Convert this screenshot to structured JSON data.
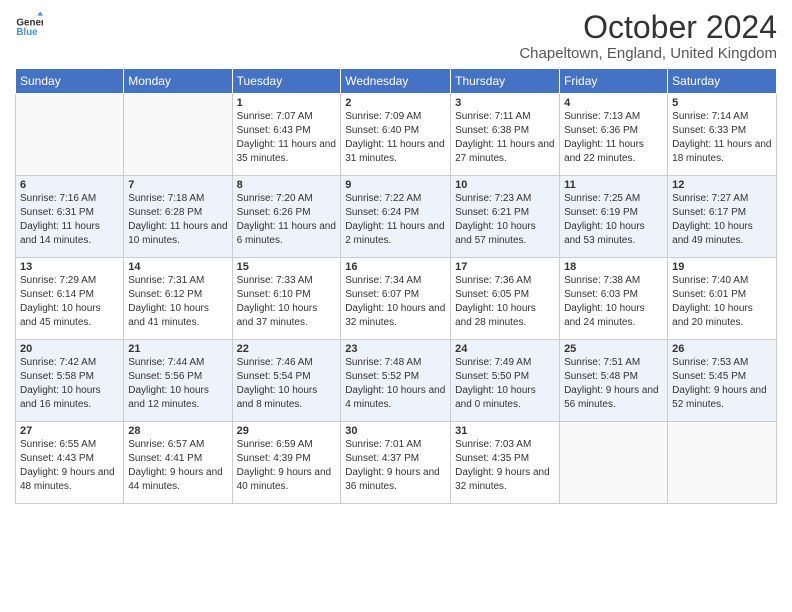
{
  "header": {
    "logo_line1": "General",
    "logo_line2": "Blue",
    "month_title": "October 2024",
    "subtitle": "Chapeltown, England, United Kingdom"
  },
  "days_of_week": [
    "Sunday",
    "Monday",
    "Tuesday",
    "Wednesday",
    "Thursday",
    "Friday",
    "Saturday"
  ],
  "weeks": [
    [
      {
        "day": "",
        "info": ""
      },
      {
        "day": "",
        "info": ""
      },
      {
        "day": "1",
        "info": "Sunrise: 7:07 AM\nSunset: 6:43 PM\nDaylight: 11 hours and 35 minutes."
      },
      {
        "day": "2",
        "info": "Sunrise: 7:09 AM\nSunset: 6:40 PM\nDaylight: 11 hours and 31 minutes."
      },
      {
        "day": "3",
        "info": "Sunrise: 7:11 AM\nSunset: 6:38 PM\nDaylight: 11 hours and 27 minutes."
      },
      {
        "day": "4",
        "info": "Sunrise: 7:13 AM\nSunset: 6:36 PM\nDaylight: 11 hours and 22 minutes."
      },
      {
        "day": "5",
        "info": "Sunrise: 7:14 AM\nSunset: 6:33 PM\nDaylight: 11 hours and 18 minutes."
      }
    ],
    [
      {
        "day": "6",
        "info": "Sunrise: 7:16 AM\nSunset: 6:31 PM\nDaylight: 11 hours and 14 minutes."
      },
      {
        "day": "7",
        "info": "Sunrise: 7:18 AM\nSunset: 6:28 PM\nDaylight: 11 hours and 10 minutes."
      },
      {
        "day": "8",
        "info": "Sunrise: 7:20 AM\nSunset: 6:26 PM\nDaylight: 11 hours and 6 minutes."
      },
      {
        "day": "9",
        "info": "Sunrise: 7:22 AM\nSunset: 6:24 PM\nDaylight: 11 hours and 2 minutes."
      },
      {
        "day": "10",
        "info": "Sunrise: 7:23 AM\nSunset: 6:21 PM\nDaylight: 10 hours and 57 minutes."
      },
      {
        "day": "11",
        "info": "Sunrise: 7:25 AM\nSunset: 6:19 PM\nDaylight: 10 hours and 53 minutes."
      },
      {
        "day": "12",
        "info": "Sunrise: 7:27 AM\nSunset: 6:17 PM\nDaylight: 10 hours and 49 minutes."
      }
    ],
    [
      {
        "day": "13",
        "info": "Sunrise: 7:29 AM\nSunset: 6:14 PM\nDaylight: 10 hours and 45 minutes."
      },
      {
        "day": "14",
        "info": "Sunrise: 7:31 AM\nSunset: 6:12 PM\nDaylight: 10 hours and 41 minutes."
      },
      {
        "day": "15",
        "info": "Sunrise: 7:33 AM\nSunset: 6:10 PM\nDaylight: 10 hours and 37 minutes."
      },
      {
        "day": "16",
        "info": "Sunrise: 7:34 AM\nSunset: 6:07 PM\nDaylight: 10 hours and 32 minutes."
      },
      {
        "day": "17",
        "info": "Sunrise: 7:36 AM\nSunset: 6:05 PM\nDaylight: 10 hours and 28 minutes."
      },
      {
        "day": "18",
        "info": "Sunrise: 7:38 AM\nSunset: 6:03 PM\nDaylight: 10 hours and 24 minutes."
      },
      {
        "day": "19",
        "info": "Sunrise: 7:40 AM\nSunset: 6:01 PM\nDaylight: 10 hours and 20 minutes."
      }
    ],
    [
      {
        "day": "20",
        "info": "Sunrise: 7:42 AM\nSunset: 5:58 PM\nDaylight: 10 hours and 16 minutes."
      },
      {
        "day": "21",
        "info": "Sunrise: 7:44 AM\nSunset: 5:56 PM\nDaylight: 10 hours and 12 minutes."
      },
      {
        "day": "22",
        "info": "Sunrise: 7:46 AM\nSunset: 5:54 PM\nDaylight: 10 hours and 8 minutes."
      },
      {
        "day": "23",
        "info": "Sunrise: 7:48 AM\nSunset: 5:52 PM\nDaylight: 10 hours and 4 minutes."
      },
      {
        "day": "24",
        "info": "Sunrise: 7:49 AM\nSunset: 5:50 PM\nDaylight: 10 hours and 0 minutes."
      },
      {
        "day": "25",
        "info": "Sunrise: 7:51 AM\nSunset: 5:48 PM\nDaylight: 9 hours and 56 minutes."
      },
      {
        "day": "26",
        "info": "Sunrise: 7:53 AM\nSunset: 5:45 PM\nDaylight: 9 hours and 52 minutes."
      }
    ],
    [
      {
        "day": "27",
        "info": "Sunrise: 6:55 AM\nSunset: 4:43 PM\nDaylight: 9 hours and 48 minutes."
      },
      {
        "day": "28",
        "info": "Sunrise: 6:57 AM\nSunset: 4:41 PM\nDaylight: 9 hours and 44 minutes."
      },
      {
        "day": "29",
        "info": "Sunrise: 6:59 AM\nSunset: 4:39 PM\nDaylight: 9 hours and 40 minutes."
      },
      {
        "day": "30",
        "info": "Sunrise: 7:01 AM\nSunset: 4:37 PM\nDaylight: 9 hours and 36 minutes."
      },
      {
        "day": "31",
        "info": "Sunrise: 7:03 AM\nSunset: 4:35 PM\nDaylight: 9 hours and 32 minutes."
      },
      {
        "day": "",
        "info": ""
      },
      {
        "day": "",
        "info": ""
      }
    ]
  ]
}
